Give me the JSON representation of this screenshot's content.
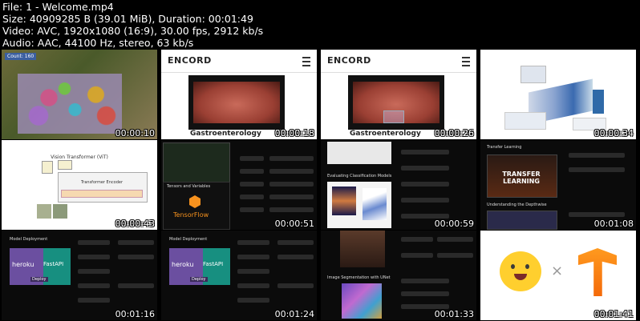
{
  "info": {
    "line1": "File: 1 - Welcome.mp4",
    "line2": "Size: 40909285 B (39.01 MiB), Duration: 00:01:49",
    "line3": "Video: AVC, 1920x1080 (16:9), 30.00 fps, 2912 kb/s",
    "line4": "Audio: AAC, 44100 Hz, stereo, 63 kb/s"
  },
  "thumbs": [
    {
      "time": "00:00:10",
      "label": "Count: 160"
    },
    {
      "time": "00:00:18",
      "logo": "ENCORD",
      "caption": "Gastroenterology"
    },
    {
      "time": "00:00:26",
      "logo": "ENCORD",
      "caption": "Gastroenterology"
    },
    {
      "time": "00:00:34"
    },
    {
      "time": "00:00:43",
      "title": "Vision Transformer (ViT)",
      "encoder": "Transformer Encoder"
    },
    {
      "time": "00:00:51",
      "brand": "TensorFlow",
      "card_label": "Tensors and Variables"
    },
    {
      "time": "00:00:59",
      "section": "Evaluating Classification Models"
    },
    {
      "time": "00:01:08",
      "banner_title": "TRANSFER LEARNING",
      "section": "Transfer Learning",
      "section2": "Understanding the Depthwise"
    },
    {
      "time": "00:01:16",
      "brand1": "heroku",
      "brand2": "FastAPI",
      "tag": "Deploy",
      "section": "Model Deployment"
    },
    {
      "time": "00:01:24",
      "brand1": "heroku",
      "brand2": "FastAPI",
      "tag": "Deploy",
      "section": "Model Deployment"
    },
    {
      "time": "00:01:33",
      "section": "Image Segmentation with UNet"
    },
    {
      "time": "00:01:41",
      "symbol": "×"
    }
  ]
}
